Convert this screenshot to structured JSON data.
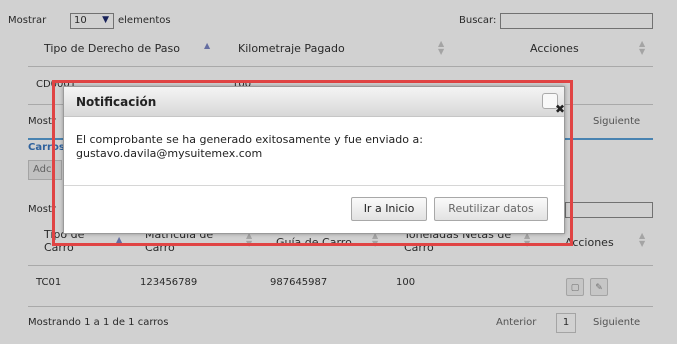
{
  "top_table": {
    "show_prefix": "Mostrar",
    "show_value": "10",
    "show_suffix": "elementos",
    "search_label": "Buscar:",
    "columns": [
      "Tipo de Derecho de Paso",
      "Kilometraje Pagado",
      "Acciones"
    ],
    "row": [
      "CD0001",
      "100"
    ],
    "info_partial": "Mostr",
    "next": "Siguiente"
  },
  "section": {
    "title_partial": "Carros",
    "add_partial": "Adc"
  },
  "bottom_table": {
    "show_partial": "Mostr",
    "columns": [
      {
        "line1": "Tipo de",
        "line2": "Carro"
      },
      {
        "line1": "Matrícula de",
        "line2": "Carro"
      },
      {
        "line1": "Guía de Carro",
        "line2": ""
      },
      {
        "line1": "Toneladas Netas de",
        "line2": "Carro"
      },
      {
        "line1": "Acciones",
        "line2": ""
      }
    ],
    "row": [
      "TC01",
      "123456789",
      "987645987",
      "100"
    ],
    "info": "Mostrando 1 a 1 de 1 carros",
    "prev": "Anterior",
    "page": "1",
    "next": "Siguiente"
  },
  "modal": {
    "title": "Notificación",
    "close": "✖",
    "message_line1": "El comprobante se ha generado exitosamente y fue enviado a:",
    "message_line2": "gustavo.davila@mysuitemex.com",
    "btn_home": "Ir a Inicio",
    "btn_reuse": "Reutilizar datos"
  },
  "colors": {
    "highlight_border": "#e04444",
    "sort_active": "#7b86c5",
    "select_chevron": "#1e2a6e"
  }
}
